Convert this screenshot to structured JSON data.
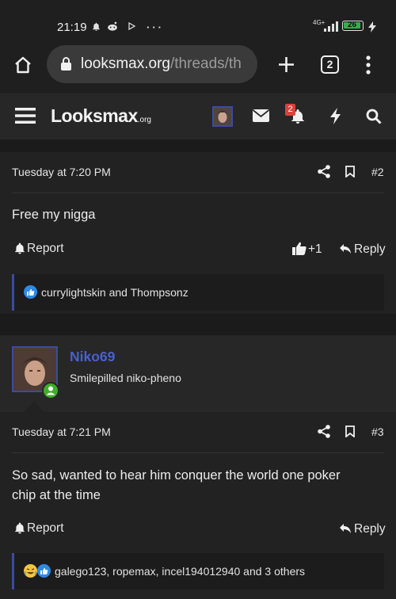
{
  "status_bar": {
    "time": "21:19",
    "network": "4G+",
    "battery": "26",
    "icons": [
      "alarm-icon",
      "reddit-icon",
      "play-icon",
      "more-dots-icon",
      "signal-icon",
      "battery-icon",
      "charging-icon"
    ]
  },
  "browser": {
    "url_host": "looksmax.org",
    "url_path": "/threads/th",
    "tab_count": "2",
    "icons": [
      "home-icon",
      "lock-icon",
      "new-tab-icon",
      "tabs-icon",
      "menu-dots-icon"
    ]
  },
  "site_header": {
    "logo_main": "Looksmax",
    "logo_suffix": ".org",
    "notification_badge": "2",
    "icons": [
      "hamburger-menu-icon",
      "avatar",
      "envelope-icon",
      "bell-icon",
      "lightning-icon",
      "search-icon"
    ],
    "colors": {
      "badge": "#d9433b"
    }
  },
  "posts": [
    {
      "date": "Tuesday at 7:20 PM",
      "number": "#2",
      "content": "Free my nigga",
      "report_label": "Report",
      "like_count": "+1",
      "reply_label": "Reply",
      "reactions": "currylightskin and Thompsonz"
    },
    {
      "author": "Niko69",
      "user_title": "Smilepilled niko-pheno",
      "date": "Tuesday at 7:21 PM",
      "number": "#3",
      "content_line1": "So sad, wanted to hear him conquer the world one poker",
      "content_line2": "chip at the time",
      "report_label": "Report",
      "reply_label": "Reply",
      "reactions": "galego123, ropemax, incel194012940 and 3 others",
      "colors": {
        "author": "#4a5fd1",
        "online": "#3fae2a"
      }
    }
  ]
}
